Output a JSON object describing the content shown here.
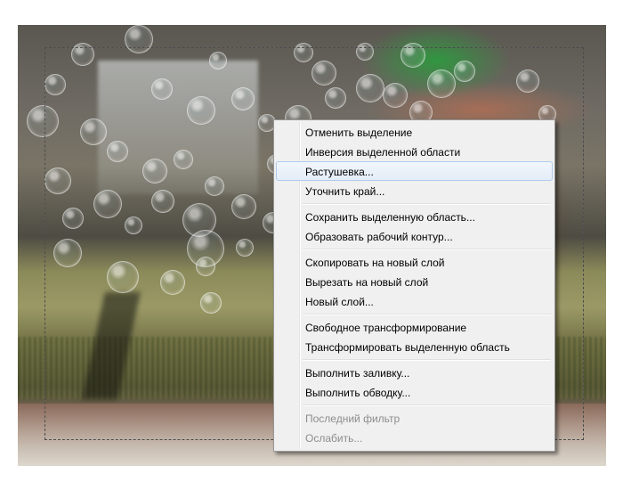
{
  "context_menu": {
    "groups": [
      [
        {
          "label": "Отменить выделение",
          "enabled": true
        },
        {
          "label": "Инверсия выделенной области",
          "enabled": true
        },
        {
          "label": "Растушевка...",
          "enabled": true,
          "highlighted": true
        },
        {
          "label": "Уточнить край...",
          "enabled": true
        }
      ],
      [
        {
          "label": "Сохранить выделенную область...",
          "enabled": true
        },
        {
          "label": "Образовать рабочий контур...",
          "enabled": true
        }
      ],
      [
        {
          "label": "Скопировать на новый слой",
          "enabled": true
        },
        {
          "label": "Вырезать на новый слой",
          "enabled": true
        },
        {
          "label": "Новый слой...",
          "enabled": true
        }
      ],
      [
        {
          "label": "Свободное трансформирование",
          "enabled": true
        },
        {
          "label": "Трансформировать выделенную область",
          "enabled": true
        }
      ],
      [
        {
          "label": "Выполнить заливку...",
          "enabled": true
        },
        {
          "label": "Выполнить обводку...",
          "enabled": true
        }
      ],
      [
        {
          "label": "Последний фильтр",
          "enabled": false
        },
        {
          "label": "Ослабить...",
          "enabled": false
        }
      ]
    ]
  },
  "colors": {
    "menu_background": "#f0f0f0",
    "menu_border": "#979797",
    "highlight_border": "#aeccef",
    "disabled_text": "#8d8d8d"
  }
}
